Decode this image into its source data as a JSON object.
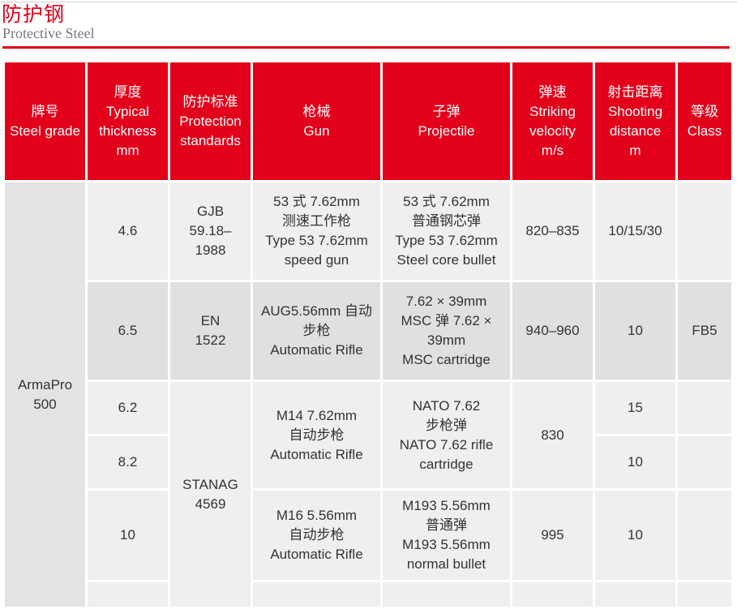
{
  "header": {
    "title_zh": "防护钢",
    "title_en": "Protective Steel"
  },
  "table": {
    "columns": [
      {
        "zh": "牌号",
        "en": [
          "Steel grade"
        ]
      },
      {
        "zh": "厚度",
        "en": [
          "Typical",
          "thickness",
          "mm"
        ]
      },
      {
        "zh": "防护标准",
        "en": [
          "Protection",
          "standards"
        ]
      },
      {
        "zh": "枪械",
        "en": [
          "Gun"
        ]
      },
      {
        "zh": "子弹",
        "en": [
          "Projectile"
        ]
      },
      {
        "zh": "弹速",
        "en": [
          "Striking",
          "velocity",
          "m/s"
        ]
      },
      {
        "zh": "射击距离",
        "en": [
          "Shooting",
          "distance",
          "m"
        ]
      },
      {
        "zh": "等级",
        "en": [
          "Class"
        ]
      }
    ],
    "steel_grade": [
      "ArmaPro",
      "500"
    ],
    "rows": [
      {
        "thickness": "4.6",
        "standard": [
          "GJB",
          "59.18–",
          "1988"
        ],
        "gun": [
          "53 式 7.62mm",
          "测速工作枪",
          "Type 53 7.62mm",
          "speed gun"
        ],
        "projectile": [
          "53 式 7.62mm",
          "普通钢芯弹",
          "Type 53 7.62mm",
          "Steel core bullet"
        ],
        "velocity": "820–835",
        "distance": "10/15/30",
        "class": ""
      },
      {
        "thickness": "6.5",
        "standard": [
          "EN",
          "1522"
        ],
        "gun": [
          "AUG5.56mm 自动",
          "步枪",
          "Automatic Rifle"
        ],
        "projectile": [
          "7.62 × 39mm",
          "MSC 弹 7.62 ×",
          "39mm",
          "MSC cartridge"
        ],
        "velocity": "940–960",
        "distance": "10",
        "class": "FB5"
      },
      {
        "thickness": "6.2",
        "distance": "15",
        "class": ""
      },
      {
        "thickness": "8.2",
        "distance": "10",
        "class": ""
      },
      {
        "thickness": "10",
        "gun": [
          "M16 5.56mm",
          "自动步枪",
          "Automatic Rifle"
        ],
        "projectile": [
          "M193 5.56mm",
          "普通弹",
          "M193 5.56mm",
          "normal bullet"
        ],
        "velocity": "995",
        "distance": "10",
        "class": ""
      }
    ],
    "merged": {
      "standard_stanag": [
        "STANAG",
        "4569"
      ],
      "gun_m14": [
        "M14 7.62mm",
        "自动步枪",
        "Automatic Rifle"
      ],
      "projectile_nato": [
        "NATO 7.62",
        "步枪弹",
        "NATO 7.62 rifle",
        "cartridge"
      ],
      "velocity_830": "830"
    }
  }
}
